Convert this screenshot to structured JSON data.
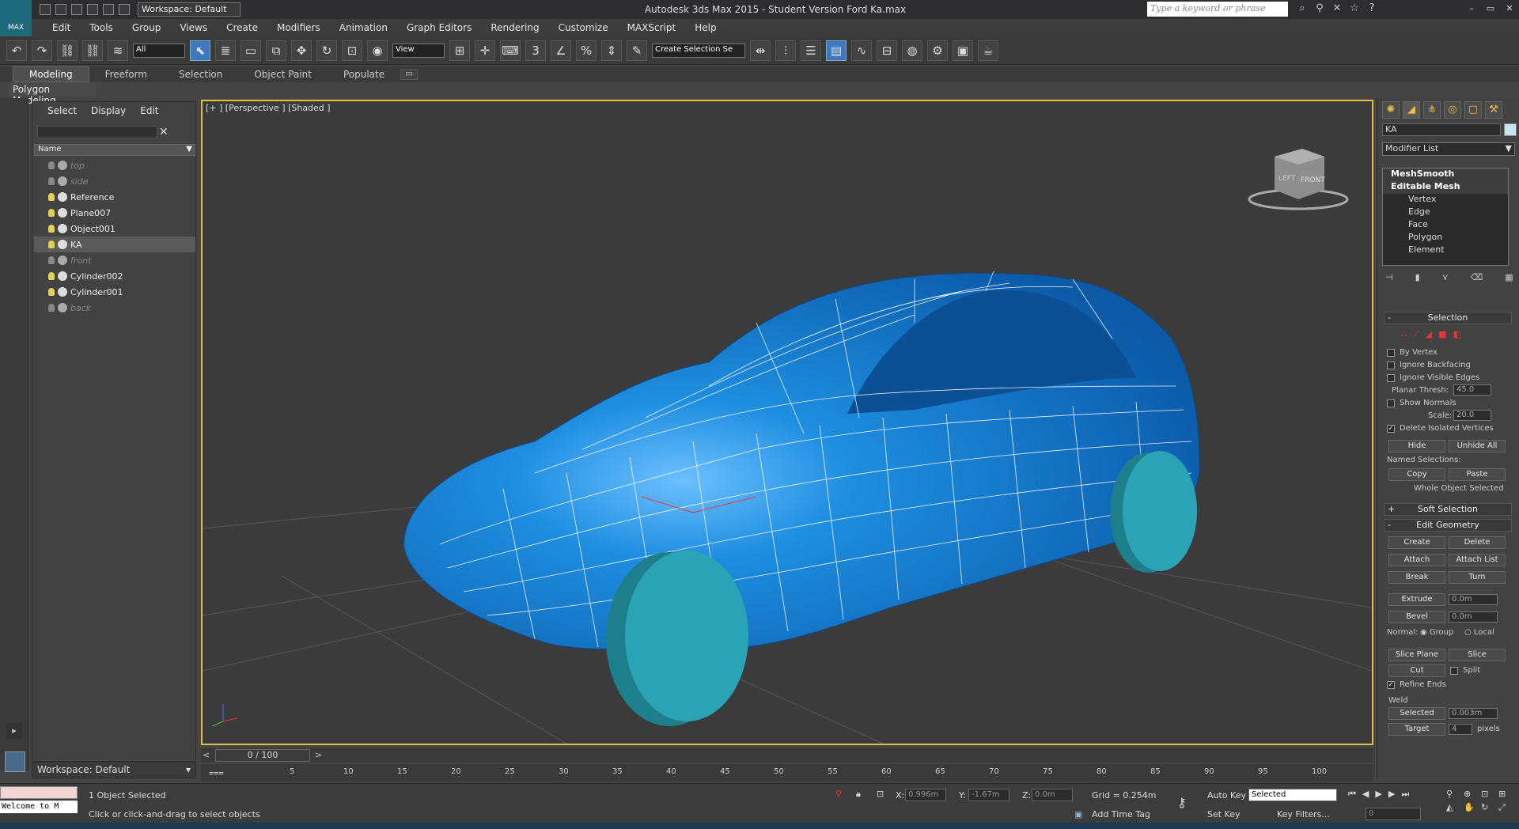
{
  "app": {
    "title": "Autodesk 3ds Max 2015  -  Student Version    Ford Ka.max",
    "workspace": "Workspace: Default",
    "search_placeholder": "Type a keyword or phrase",
    "logo": "MAX"
  },
  "menu": [
    "Edit",
    "Tools",
    "Group",
    "Views",
    "Create",
    "Modifiers",
    "Animation",
    "Graph Editors",
    "Rendering",
    "Customize",
    "MAXScript",
    "Help"
  ],
  "toolbar": {
    "filter": "All",
    "ref_coord": "View",
    "selection_set": "Create Selection Se"
  },
  "ribbon": {
    "tabs": [
      "Modeling",
      "Freeform",
      "Selection",
      "Object Paint",
      "Populate"
    ],
    "active_tab": "Modeling",
    "panel_label": "Polygon Modeling"
  },
  "scene_explorer": {
    "menu": [
      "Select",
      "Display",
      "Edit"
    ],
    "column_header": "Name",
    "objects": [
      {
        "name": "top",
        "hidden": true
      },
      {
        "name": "side",
        "hidden": true
      },
      {
        "name": "Reference",
        "hidden": false
      },
      {
        "name": "Plane007",
        "hidden": false
      },
      {
        "name": "Object001",
        "hidden": false
      },
      {
        "name": "KA",
        "hidden": false,
        "selected": true
      },
      {
        "name": "front",
        "hidden": true
      },
      {
        "name": "Cylinder002",
        "hidden": false
      },
      {
        "name": "Cylinder001",
        "hidden": false
      },
      {
        "name": "back",
        "hidden": true
      }
    ],
    "workspace": "Workspace: Default"
  },
  "viewport": {
    "label": "[+ ] [Perspective ] [Shaded ]",
    "viewcube_left": "LEFT",
    "viewcube_front": "FRONT",
    "car_color": "#1e8ee0",
    "wheel_color": "#2aa3b4"
  },
  "command_panel": {
    "object_name": "KA",
    "modifier_list": "Modifier List",
    "stack": [
      {
        "label": "MeshSmooth",
        "type": "modifier"
      },
      {
        "label": "Editable Mesh",
        "type": "base"
      },
      {
        "label": "Vertex",
        "type": "sub"
      },
      {
        "label": "Edge",
        "type": "sub"
      },
      {
        "label": "Face",
        "type": "sub"
      },
      {
        "label": "Polygon",
        "type": "sub"
      },
      {
        "label": "Element",
        "type": "sub"
      }
    ],
    "selection": {
      "title": "Selection",
      "by_vertex": "By Vertex",
      "ignore_backfacing": "Ignore Backfacing",
      "ignore_visible_edges": "Ignore Visible Edges",
      "planar_thresh_label": "Planar Thresh:",
      "planar_thresh": "45.0",
      "show_normals": "Show Normals",
      "scale_label": "Scale:",
      "scale": "20.0",
      "delete_isolated": "Delete Isolated Vertices",
      "hide": "Hide",
      "unhide_all": "Unhide All",
      "named_selections": "Named Selections:",
      "copy": "Copy",
      "paste": "Paste",
      "whole_object": "Whole Object Selected"
    },
    "soft_selection": "Soft Selection",
    "edit_geometry": {
      "title": "Edit Geometry",
      "create": "Create",
      "delete": "Delete",
      "attach": "Attach",
      "attach_list": "Attach List",
      "break": "Break",
      "turn": "Turn",
      "extrude": "Extrude",
      "extrude_val": "0.0m",
      "bevel": "Bevel",
      "bevel_val": "0.0m",
      "normal_label": "Normal:",
      "group": "Group",
      "local": "Local",
      "slice_plane": "Slice Plane",
      "slice": "Slice",
      "cut": "Cut",
      "split": "Split",
      "refine_ends": "Refine Ends",
      "weld": "Weld",
      "selected": "Selected",
      "selected_val": "0.003m",
      "target": "Target",
      "target_val": "4",
      "pixels": "pixels"
    }
  },
  "timeline": {
    "frame_box": "0 / 100",
    "ticks": [
      "5",
      "10",
      "15",
      "20",
      "25",
      "30",
      "35",
      "40",
      "45",
      "50",
      "55",
      "60",
      "65",
      "70",
      "75",
      "80",
      "85",
      "90",
      "95",
      "100"
    ]
  },
  "status": {
    "selected": "1 Object Selected",
    "prompt": "Click or click-and-drag to select objects",
    "maxscript": "Welcome to M",
    "x_label": "X:",
    "x": "0.996m",
    "y_label": "Y:",
    "y": "-1.67m",
    "z_label": "Z:",
    "z": "0.0m",
    "grid": "Grid = 0.254m",
    "add_time_tag": "Add Time Tag",
    "auto_key": "Auto Key",
    "set_key": "Set Key",
    "key_mode": "Selected",
    "key_filters": "Key Filters...",
    "frame": "0"
  }
}
